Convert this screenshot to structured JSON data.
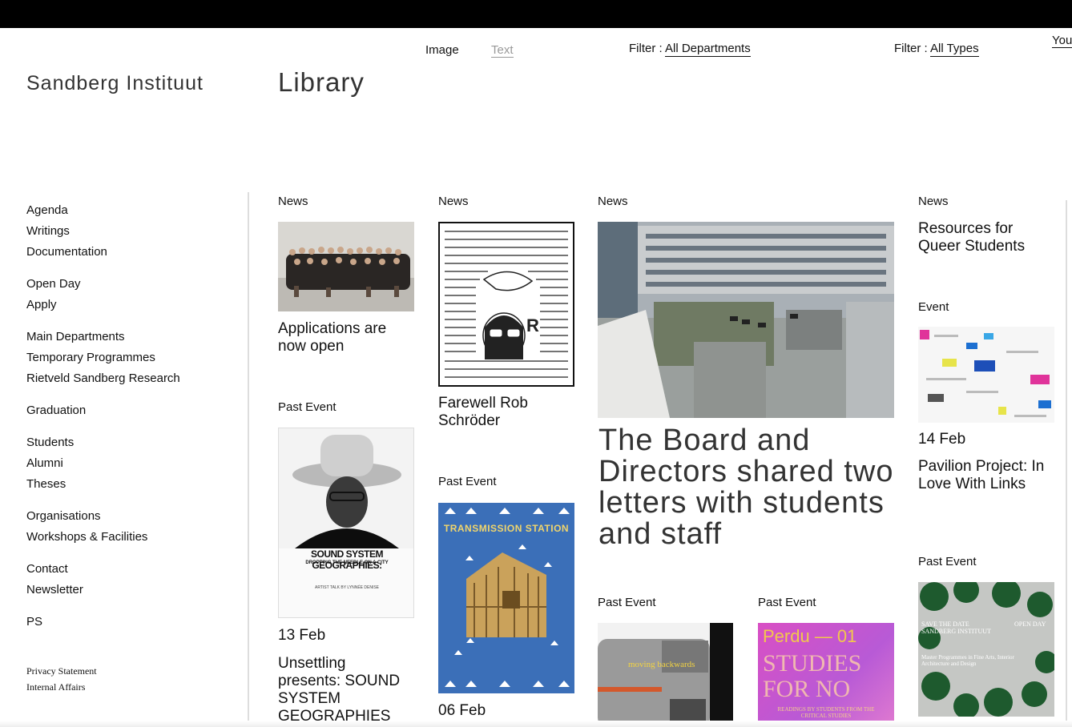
{
  "header": {
    "brand": "Sandberg Instituut",
    "page_title": "Library",
    "view_toggle": {
      "image": "Image",
      "text": "Text"
    },
    "filters": [
      {
        "label": "Filter : ",
        "value": "All Departments"
      },
      {
        "label": "Filter : ",
        "value": "All Types"
      }
    ],
    "user_partial": "You"
  },
  "nav": {
    "groups": [
      [
        "Agenda",
        "Writings",
        "Documentation"
      ],
      [
        "Open Day",
        "Apply"
      ],
      [
        "Main Departments",
        "Temporary Programmes",
        "Rietveld Sandberg Research"
      ],
      [
        "Graduation"
      ],
      [
        "Students",
        "Alumni",
        "Theses"
      ],
      [
        "Organisations",
        "Workshops & Facilities"
      ],
      [
        "Contact",
        "Newsletter"
      ],
      [
        "PS"
      ]
    ],
    "footer": [
      "Privacy Statement",
      "Internal Affairs"
    ]
  },
  "cards": {
    "c1": {
      "category": "News",
      "title": "Applications are now open"
    },
    "c2": {
      "category": "Past Event",
      "date": "13 Feb",
      "title": "Unsettling presents: SOUND SYSTEM GEOGRAPHIES",
      "poster_heading": "SOUND SYSTEM GEOGRAPHIES:",
      "poster_sub": "DROPPING THE NEEDLE ON A CITY",
      "poster_artist": "ARTIST TALK BY LYNNÉE DENISE"
    },
    "c3": {
      "category": "News",
      "title": "Farewell Rob Schröder"
    },
    "c4": {
      "category": "Past Event",
      "date": "06 Feb",
      "poster_heading": "TRANSMISSION STATION"
    },
    "c5": {
      "category": "News",
      "title": "The Board and Directors shared two letters with students and staff"
    },
    "c6": {
      "category": "Past Event",
      "poster_text": "moving backwards"
    },
    "c7": {
      "category": "Past Event",
      "poster_top": "Perdu — 01",
      "poster_main1": "STUDIES",
      "poster_main2": "FOR NO",
      "poster_sub": "READINGS BY STUDENTS FROM THE CRITICAL STUDIES"
    },
    "c8": {
      "category": "News",
      "title": "Resources for Queer Students"
    },
    "c9": {
      "category": "Event",
      "date": "14 Feb",
      "title": "Pavilion Project: In Love With Links"
    },
    "c10": {
      "category": "Past Event",
      "poster_left": "SAVE THE DATE SANDBERG INSTITUUT",
      "poster_right": "OPEN DAY",
      "poster_mid": "Master Programmes in Fine Arts, Interior Architecture and Design"
    }
  },
  "colors": {
    "topbar": "#000000",
    "transmission_bg": "#3b6fb8",
    "perdu_bg": "#d94fc4"
  }
}
